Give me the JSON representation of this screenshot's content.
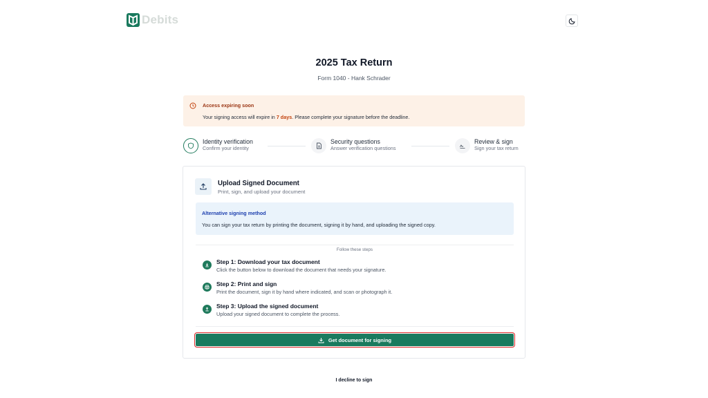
{
  "brand": {
    "name": "Debits",
    "color": "#1a7a5e"
  },
  "header": {
    "theme_toggle_icon": "moon-icon"
  },
  "page": {
    "title": "2025 Tax Return",
    "subtitle": "Form 1040 - Hank Schrader"
  },
  "alert": {
    "title": "Access expiring soon",
    "body_prefix": "Your signing access will expire in ",
    "days": "7 days",
    "body_suffix": ". Please complete your signature before the deadline.",
    "icon": "clock-icon"
  },
  "stepper": {
    "steps": [
      {
        "title": "Identity verification",
        "subtitle": "Confirm your identity",
        "icon": "shield-icon",
        "state": "active"
      },
      {
        "title": "Security questions",
        "subtitle": "Answer verification questions",
        "icon": "document-icon",
        "state": "pending"
      },
      {
        "title": "Review & sign",
        "subtitle": "Sign your tax return",
        "icon": "signature-icon",
        "state": "pending"
      }
    ]
  },
  "card": {
    "title": "Upload Signed Document",
    "subtitle": "Print, sign, and upload your document",
    "icon": "upload-icon",
    "info": {
      "title": "Alternative signing method",
      "body": "You can sign your tax return by printing the document, signing it by hand, and uploading the signed copy."
    },
    "divider_label": "Follow these steps",
    "steps": [
      {
        "title": "Step 1: Download your tax document",
        "body": "Click the button below to download the document that needs your signature.",
        "icon": "download-icon"
      },
      {
        "title": "Step 2: Print and sign",
        "body": "Print the document, sign it by hand where indicated, and scan or photograph it.",
        "icon": "printer-icon"
      },
      {
        "title": "Step 3: Upload the signed document",
        "body": "Upload your signed document to complete the process.",
        "icon": "upload-icon"
      }
    ],
    "button_label": "Get document for signing",
    "button_icon": "download-icon"
  },
  "footer": {
    "decline_label": "I decline to sign"
  }
}
